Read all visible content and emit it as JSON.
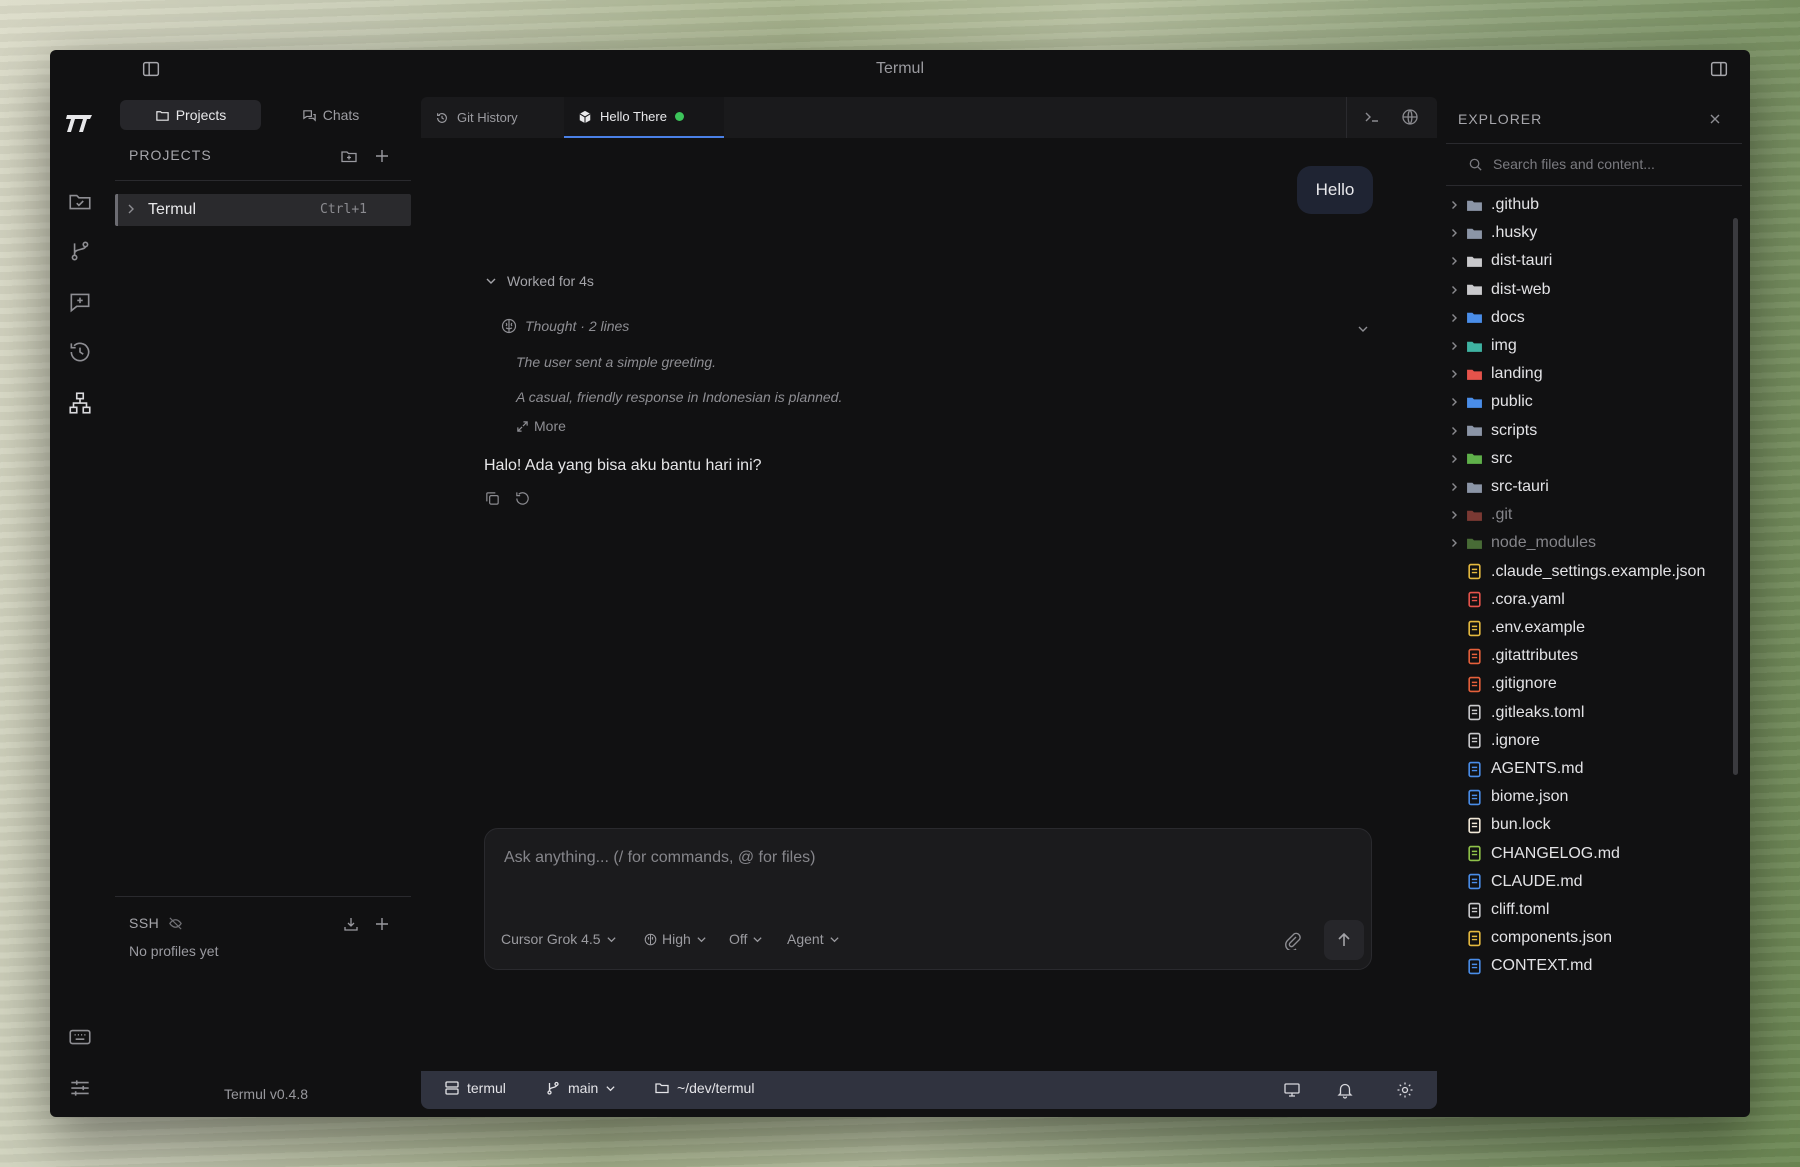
{
  "window": {
    "title": "Termul"
  },
  "projects_panel": {
    "tabs": [
      {
        "label": "Projects"
      },
      {
        "label": "Chats"
      }
    ],
    "section_title": "PROJECTS",
    "items": [
      {
        "name": "Termul",
        "shortcut": "Ctrl+1"
      }
    ],
    "ssh": {
      "title": "SSH",
      "empty_text": "No profiles yet"
    },
    "version": "Termul v0.4.8"
  },
  "editor_tabs": [
    {
      "label": "Git History"
    },
    {
      "label": "Hello There",
      "status_color": "#3cc45a"
    }
  ],
  "chat": {
    "user_message": "Hello",
    "worked_label": "Worked for 4s",
    "thought_label": "Thought · 2 lines",
    "thought_lines": [
      "The user sent a simple greeting.",
      "A casual, friendly response in Indonesian is planned."
    ],
    "more_label": "More",
    "assistant_reply": "Halo! Ada yang bisa aku bantu hari ini?"
  },
  "composer": {
    "placeholder": "Ask anything... (/ for commands, @ for files)",
    "model": "Cursor Grok 4.5",
    "effort": "High",
    "toggle": "Off",
    "mode": "Agent"
  },
  "statusbar": {
    "workspace": "termul",
    "branch": "main",
    "path": "~/dev/termul"
  },
  "explorer": {
    "title": "EXPLORER",
    "search_placeholder": "Search files and content...",
    "items": [
      {
        "name": ".github",
        "type": "folder",
        "icon": "folder-github-icon",
        "color": "#8b95a6"
      },
      {
        "name": ".husky",
        "type": "folder",
        "icon": "folder-husky-icon",
        "color": "#8b95a6"
      },
      {
        "name": "dist-tauri",
        "type": "folder",
        "icon": "folder-dist-icon",
        "color": "#c9c9cc"
      },
      {
        "name": "dist-web",
        "type": "folder",
        "icon": "folder-dist-icon",
        "color": "#c9c9cc"
      },
      {
        "name": "docs",
        "type": "folder",
        "icon": "folder-docs-icon",
        "color": "#4a8de8"
      },
      {
        "name": "img",
        "type": "folder",
        "icon": "folder-images-icon",
        "color": "#3fb3a2"
      },
      {
        "name": "landing",
        "type": "folder",
        "icon": "folder-landing-icon",
        "color": "#e5534b"
      },
      {
        "name": "public",
        "type": "folder",
        "icon": "folder-public-icon",
        "color": "#4a8de8"
      },
      {
        "name": "scripts",
        "type": "folder",
        "icon": "folder-scripts-icon",
        "color": "#8b95a6"
      },
      {
        "name": "src",
        "type": "folder",
        "icon": "folder-src-icon",
        "color": "#5fb04a"
      },
      {
        "name": "src-tauri",
        "type": "folder",
        "icon": "folder-tauri-icon",
        "color": "#8b95a6"
      },
      {
        "name": ".git",
        "type": "folder",
        "icon": "folder-git-icon",
        "color": "#c2554a",
        "dim": true
      },
      {
        "name": "node_modules",
        "type": "folder",
        "icon": "folder-node-icon",
        "color": "#6ea84e",
        "dim": true
      },
      {
        "name": ".claude_settings.example.json",
        "type": "file",
        "icon": "json-icon",
        "color": "#e5b93f"
      },
      {
        "name": ".cora.yaml",
        "type": "file",
        "icon": "yaml-icon",
        "color": "#e5534b"
      },
      {
        "name": ".env.example",
        "type": "file",
        "icon": "env-icon",
        "color": "#e5b93f"
      },
      {
        "name": ".gitattributes",
        "type": "file",
        "icon": "git-icon",
        "color": "#e5603b"
      },
      {
        "name": ".gitignore",
        "type": "file",
        "icon": "git-icon",
        "color": "#e5603b"
      },
      {
        "name": ".gitleaks.toml",
        "type": "file",
        "icon": "toml-icon",
        "color": "#c9c9cc"
      },
      {
        "name": ".ignore",
        "type": "file",
        "icon": "file-icon",
        "color": "#c9c9cc"
      },
      {
        "name": "AGENTS.md",
        "type": "file",
        "icon": "markdown-icon",
        "color": "#4a8de8"
      },
      {
        "name": "biome.json",
        "type": "file",
        "icon": "biome-icon",
        "color": "#4a8de8"
      },
      {
        "name": "bun.lock",
        "type": "file",
        "icon": "bun-icon",
        "color": "#f2e9d8"
      },
      {
        "name": "CHANGELOG.md",
        "type": "file",
        "icon": "changelog-icon",
        "color": "#8fc24a"
      },
      {
        "name": "CLAUDE.md",
        "type": "file",
        "icon": "markdown-icon",
        "color": "#4a8de8"
      },
      {
        "name": "cliff.toml",
        "type": "file",
        "icon": "toml-icon",
        "color": "#c9c9cc"
      },
      {
        "name": "components.json",
        "type": "file",
        "icon": "json-icon",
        "color": "#e5b93f"
      },
      {
        "name": "CONTEXT.md",
        "type": "file",
        "icon": "markdown-icon",
        "color": "#4a8de8"
      }
    ]
  }
}
